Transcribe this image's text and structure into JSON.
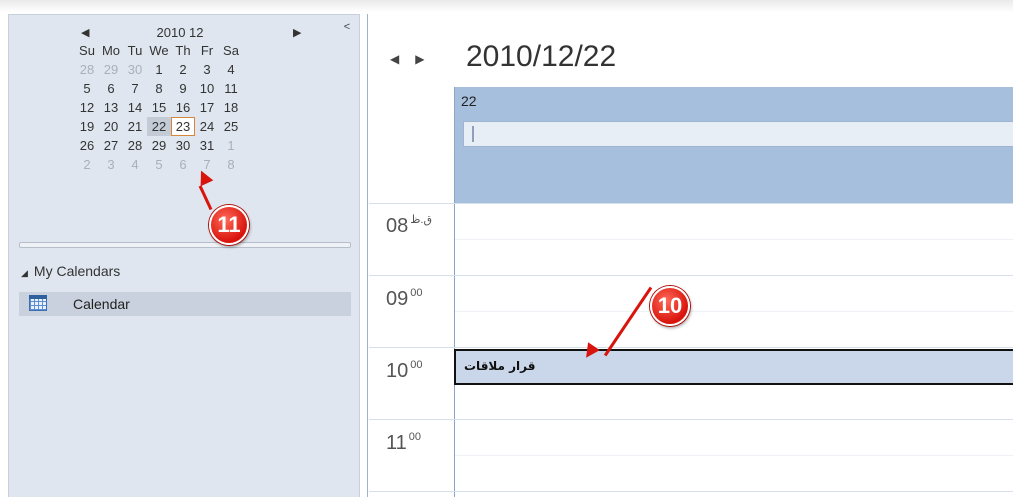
{
  "mini_calendar": {
    "title": "2010 12",
    "prev_glyph": "◀",
    "next_glyph": "▶",
    "collapse_glyph": "<",
    "day_names": [
      "Su",
      "Mo",
      "Tu",
      "We",
      "Th",
      "Fr",
      "Sa"
    ],
    "weeks": [
      [
        "28",
        "29",
        "30",
        "1",
        "2",
        "3",
        "4"
      ],
      [
        "5",
        "6",
        "7",
        "8",
        "9",
        "10",
        "11"
      ],
      [
        "12",
        "13",
        "14",
        "15",
        "16",
        "17",
        "18"
      ],
      [
        "19",
        "20",
        "21",
        "22",
        "23",
        "24",
        "25"
      ],
      [
        "26",
        "27",
        "28",
        "29",
        "30",
        "31",
        "1"
      ],
      [
        "2",
        "3",
        "4",
        "5",
        "6",
        "7",
        "8"
      ]
    ]
  },
  "folders": {
    "section_label": "My Calendars",
    "calendar_label": "Calendar"
  },
  "day_view": {
    "nav_prev": "◀",
    "nav_next": "▶",
    "date_title": "2010/12/22",
    "day_number": "22",
    "times": [
      {
        "hour": "08",
        "suffix": "ق.ظ"
      },
      {
        "hour": "09",
        "suffix": "00"
      },
      {
        "hour": "10",
        "suffix": "00"
      },
      {
        "hour": "11",
        "suffix": "00"
      }
    ],
    "appointment": "قرار ملاقات"
  },
  "annotations": {
    "badge_10": "10",
    "badge_11": "11"
  },
  "colors": {
    "sidebar_bg": "#dfe6ef",
    "day_header": "#a5bfdd",
    "appointment_bg": "#cad7ea",
    "today_border": "#d8873a",
    "annotation_red": "#d8140c"
  }
}
